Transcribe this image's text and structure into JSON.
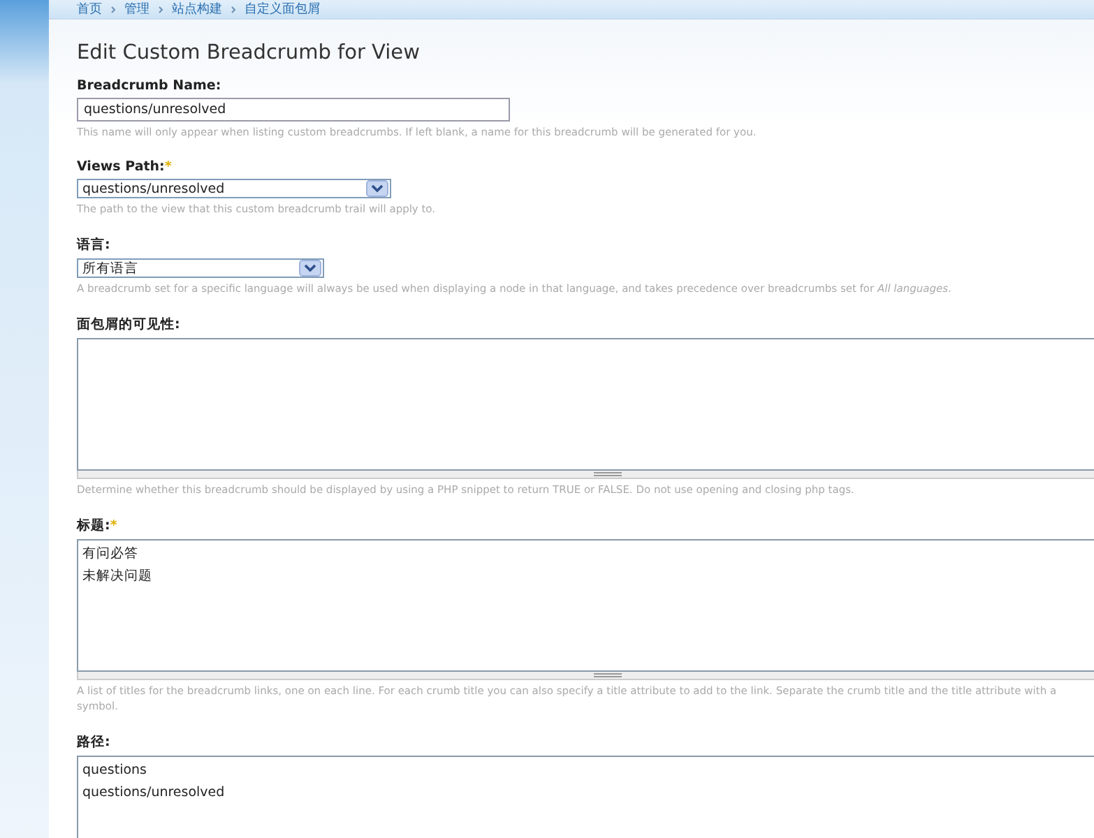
{
  "breadcrumb": [
    "首页",
    "管理",
    "站点构建",
    "自定义面包屑"
  ],
  "heading": "Edit Custom Breadcrumb for View",
  "fields": [
    {
      "kind": "text",
      "label": "Breadcrumb Name:",
      "value": "questions/unresolved",
      "description": "This name will only appear when listing custom breadcrumbs. If left blank, a name for this breadcrumb will be generated for you."
    },
    {
      "kind": "select",
      "label": "Views Path:",
      "marker": "*",
      "value": "questions/unresolved",
      "description": "The path to the view that this custom breadcrumb trail will apply to."
    },
    {
      "kind": "select-short",
      "label": "语言:",
      "value": "所有语言",
      "description": "A breadcrumb set for a specific language will always be used when displaying a node in that language, and takes precedence over breadcrumbs set for *All languages*."
    },
    {
      "kind": "textarea",
      "label": "面包屑的可见性:",
      "description": "Determine whether this breadcrumb should be displayed by using a PHP snippet to return TRUE or FALSE. Do not use opening and closing php tags."
    },
    {
      "kind": "textarea",
      "label": "标题:",
      "marker": "*",
      "lines": [
        "有问必答",
        "未解决问题"
      ],
      "description": "A list of titles for the breadcrumb links, one on each line. For each crumb title you can also specify a title attribute to add to the link. Separate the crumb title and the title attribute with a symbol."
    },
    {
      "kind": "textarea-open",
      "label": "路径:",
      "lines": [
        "questions",
        "questions/unresolved"
      ]
    }
  ]
}
